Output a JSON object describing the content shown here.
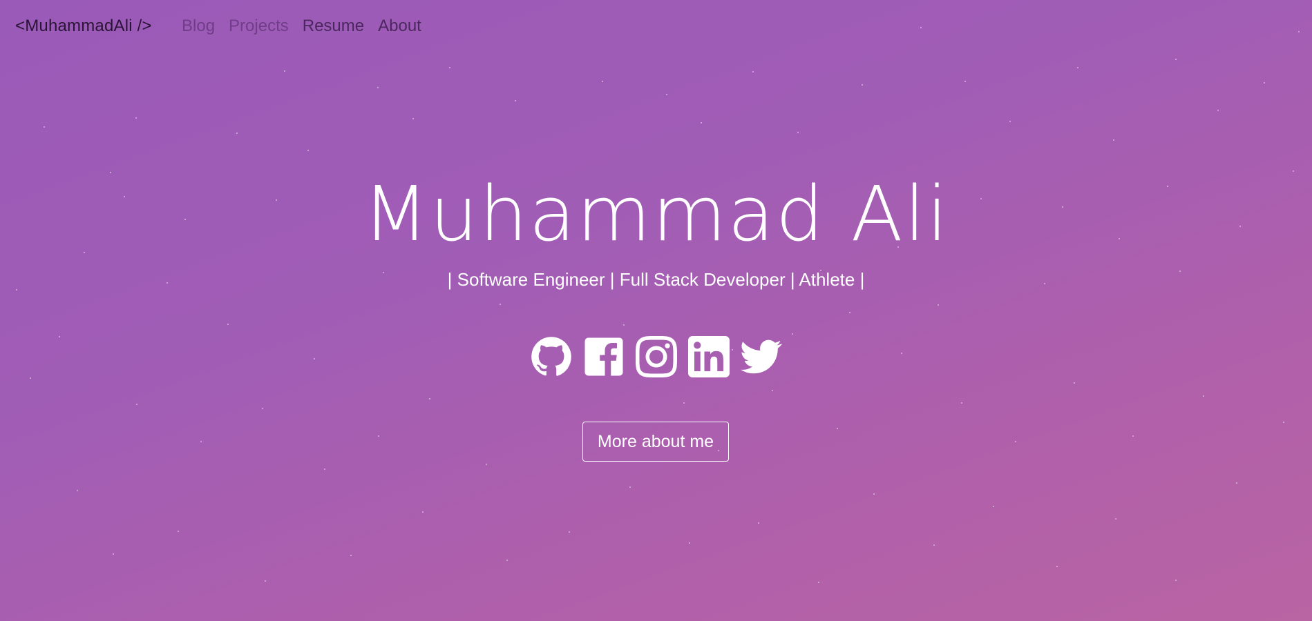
{
  "navbar": {
    "brand": "<MuhammadAli />",
    "links": [
      {
        "label": "Blog",
        "state": "muted"
      },
      {
        "label": "Projects",
        "state": "muted"
      },
      {
        "label": "Resume",
        "state": "active"
      },
      {
        "label": "About",
        "state": "active"
      }
    ]
  },
  "hero": {
    "name": "Muhammad Ali",
    "tagline": "| Software Engineer | Full Stack Developer | Athlete |",
    "social": [
      {
        "icon": "github-icon"
      },
      {
        "icon": "facebook-icon"
      },
      {
        "icon": "instagram-icon"
      },
      {
        "icon": "linkedin-icon"
      },
      {
        "icon": "twitter-icon"
      }
    ],
    "cta_label": "More about me"
  },
  "colors": {
    "gradient_start": "#9a5ab8",
    "gradient_end": "#b964a3",
    "text_light": "#ffffff",
    "nav_text": "#2a1436"
  }
}
